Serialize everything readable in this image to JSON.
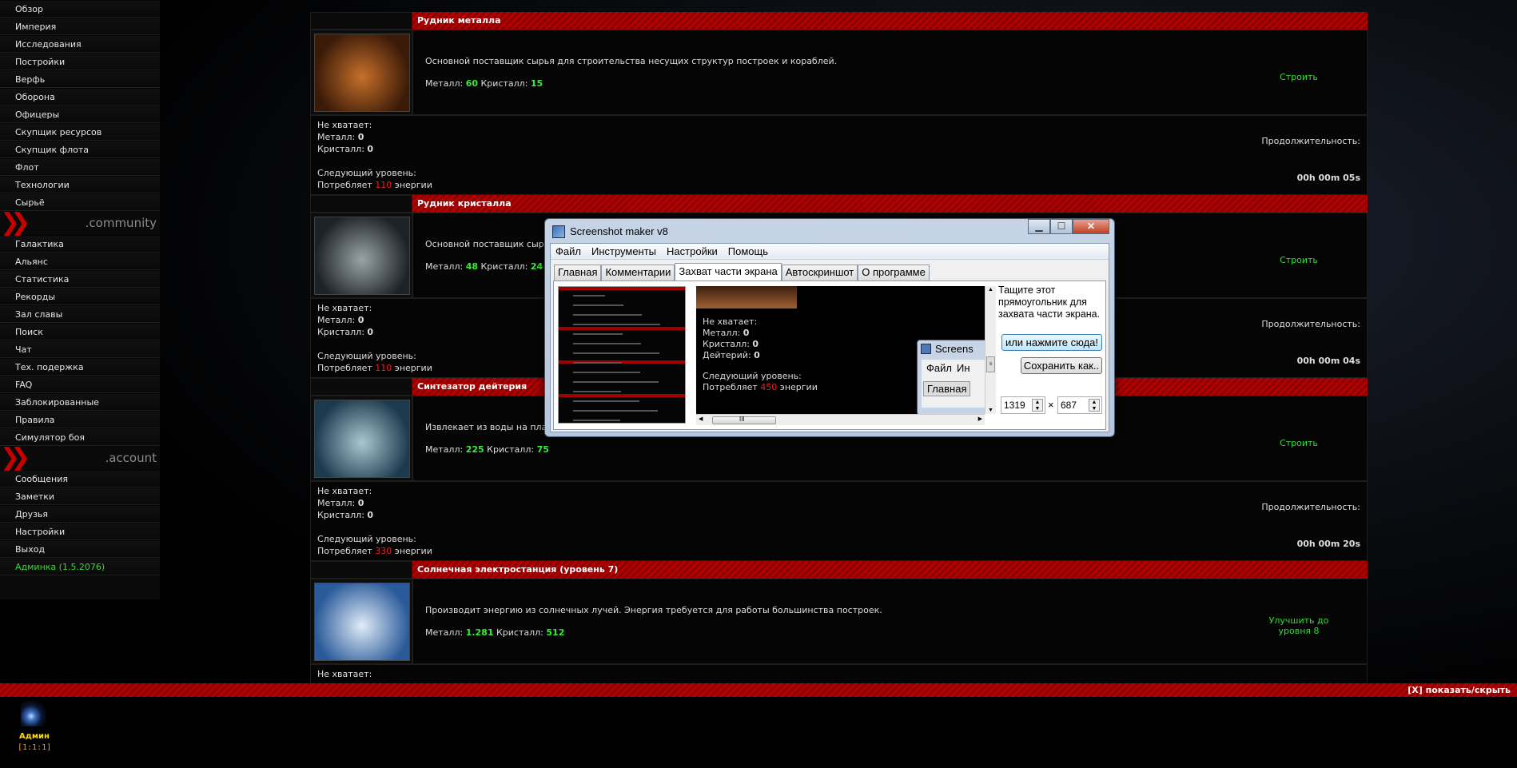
{
  "sidebar": {
    "items_main": [
      "Обзор",
      "Империя",
      "Исследования",
      "Постройки",
      "Верфь",
      "Оборона",
      "Офицеры",
      "Скупщик ресурсов",
      "Скупщик флота",
      "Флот",
      "Технологии",
      "Сырьё"
    ],
    "section_community": ".community",
    "items_community": [
      "Галактика",
      "Альянс",
      "Статистика",
      "Рекорды",
      "Зал славы",
      "Поиск",
      "Чат",
      "Тех. подержка",
      "FAQ",
      "Заблокированные",
      "Правила",
      "Симулятор боя"
    ],
    "section_account": ".account",
    "items_account": [
      "Сообщения",
      "Заметки",
      "Друзья",
      "Настройки",
      "Выход"
    ],
    "admin": "Админка (1.5.2076)"
  },
  "labels": {
    "metal": "Металл:",
    "crystal": "Кристалл:",
    "deuterium": "Дейтерий:",
    "missing": "Не хватает:",
    "next_level": "Следующий уровень:",
    "consumes": "Потребляет",
    "energy": "энергии",
    "duration": "Продолжительность:"
  },
  "buildings": [
    {
      "title": "Рудник металла",
      "description": "Основной поставщик сырья для строительства несущих структур построек и кораблей.",
      "metal": "60",
      "crystal": "15",
      "action": "Строить",
      "missing_metal": "0",
      "missing_crystal": "0",
      "energy": "110",
      "time": "00h 00m 05s",
      "image_colors": [
        "#3a1a08",
        "#c8702a"
      ]
    },
    {
      "title": "Рудник кристалла",
      "description": "Основной поставщик сырья для электронных строительных элементов и сплавов.",
      "metal": "48",
      "crystal": "24",
      "action": "Строить",
      "missing_metal": "0",
      "missing_crystal": "0",
      "energy": "110",
      "time": "00h 00m 04s",
      "image_colors": [
        "#1c2226",
        "#9aa4a8"
      ]
    },
    {
      "title": "Синтезатор дейтерия",
      "description": "Извлекает из воды на планете малую долю дейтерия.",
      "metal": "225",
      "crystal": "75",
      "action": "Строить",
      "missing_metal": "0",
      "missing_crystal": "0",
      "energy": "330",
      "time": "00h 00m 20s",
      "image_colors": [
        "#1c3a4e",
        "#a8c8d0"
      ]
    },
    {
      "title": "Солнечная электростанция (уровень 7)",
      "description": "Производит энергию из солнечных лучей. Энергия требуется для работы большинства построек.",
      "metal": "1.281",
      "crystal": "512",
      "action": "Улучшить до уровня 8",
      "image_colors": [
        "#2a5a9a",
        "#e0ecf8"
      ]
    }
  ],
  "bottom": {
    "toggle": "[X] показать/скрыть",
    "player": "Админ",
    "coords": "[1:1:1]"
  },
  "window": {
    "title": "Screenshot maker v8",
    "menu": [
      "Файл",
      "Инструменты",
      "Настройки",
      "Помощь"
    ],
    "tabs": [
      "Главная",
      "Комментарии",
      "Захват части экрана",
      "Автоскриншот",
      "О программе"
    ],
    "active_tab": "Захват части экрана",
    "hint": "Тащите этот прямоугольник для захвата части экрана.",
    "btn_click": "или нажмите сюда!",
    "btn_save": "Сохранить как..",
    "width_value": "1319",
    "times": "×",
    "height_value": "687",
    "preview": {
      "missing": "Не хватает:",
      "metal": "Металл:",
      "metal_v": "0",
      "crystal": "Кристалл:",
      "crystal_v": "0",
      "deut": "Дейтерий:",
      "deut_v": "0",
      "next": "Следующий уровень:",
      "consumes": "Потребляет",
      "energy_v": "450",
      "energy": "энергии",
      "mini_title": "Screens",
      "mini_menu1": "Файл",
      "mini_menu2": "Ин",
      "mini_tab": "Главная"
    },
    "scroll_grip": "III"
  }
}
